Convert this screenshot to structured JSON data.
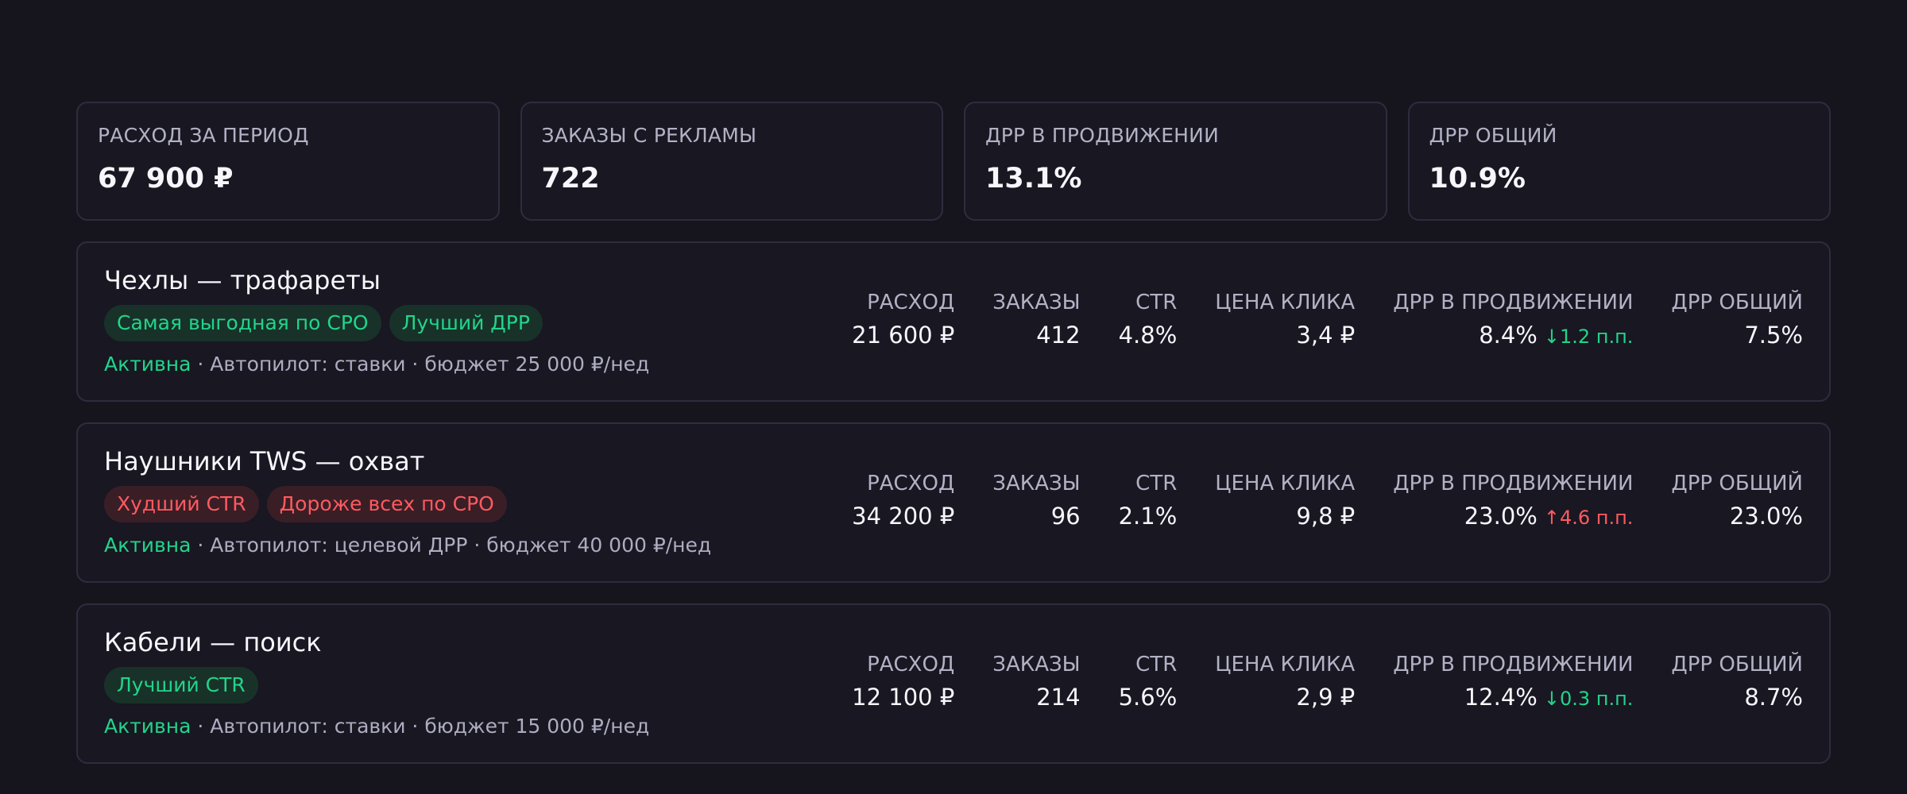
{
  "kpis": [
    {
      "label": "РАСХОД ЗА ПЕРИОД",
      "value": "67 900 ₽"
    },
    {
      "label": "ЗАКАЗЫ С РЕКЛАМЫ",
      "value": "722"
    },
    {
      "label": "ДРР В ПРОДВИЖЕНИИ",
      "value": "13.1%"
    },
    {
      "label": "ДРР ОБЩИЙ",
      "value": "10.9%"
    }
  ],
  "metric_labels": {
    "spend": "РАСХОД",
    "orders": "ЗАКАЗЫ",
    "ctr": "CTR",
    "cpc": "ЦЕНА КЛИКА",
    "drr_promo": "ДРР В ПРОДВИЖЕНИИ",
    "drr_total": "ДРР ОБЩИЙ"
  },
  "colors": {
    "background": "#16151e",
    "good": "#22d48a",
    "bad": "#ff5a5f"
  },
  "campaigns": [
    {
      "title": "Чехлы — трафареты",
      "badges": [
        {
          "text": "Самая выгодная по СРО",
          "tone": "good"
        },
        {
          "text": "Лучший ДРР",
          "tone": "good"
        }
      ],
      "status": "Активна",
      "details": "· Автопилот: ставки · бюджет 25 000 ₽/нед",
      "spend": "21 600 ₽",
      "orders": "412",
      "ctr": "4.8%",
      "cpc": "3,4 ₽",
      "drr_promo": "8.4%",
      "drr_delta": "↓1.2 п.п.",
      "drr_delta_dir": "down",
      "drr_total": "7.5%"
    },
    {
      "title": "Наушники TWS — охват",
      "badges": [
        {
          "text": "Худший CTR",
          "tone": "bad"
        },
        {
          "text": "Дороже всех по СРО",
          "tone": "bad"
        }
      ],
      "status": "Активна",
      "details": "· Автопилот: целевой ДРР · бюджет 40 000 ₽/нед",
      "spend": "34 200 ₽",
      "orders": "96",
      "ctr": "2.1%",
      "cpc": "9,8 ₽",
      "drr_promo": "23.0%",
      "drr_delta": "↑4.6 п.п.",
      "drr_delta_dir": "up",
      "drr_total": "23.0%"
    },
    {
      "title": "Кабели — поиск",
      "badges": [
        {
          "text": "Лучший CTR",
          "tone": "good"
        }
      ],
      "status": "Активна",
      "details": "· Автопилот: ставки · бюджет 15 000 ₽/нед",
      "spend": "12 100 ₽",
      "orders": "214",
      "ctr": "5.6%",
      "cpc": "2,9 ₽",
      "drr_promo": "12.4%",
      "drr_delta": "↓0.3 п.п.",
      "drr_delta_dir": "down",
      "drr_total": "8.7%"
    }
  ]
}
